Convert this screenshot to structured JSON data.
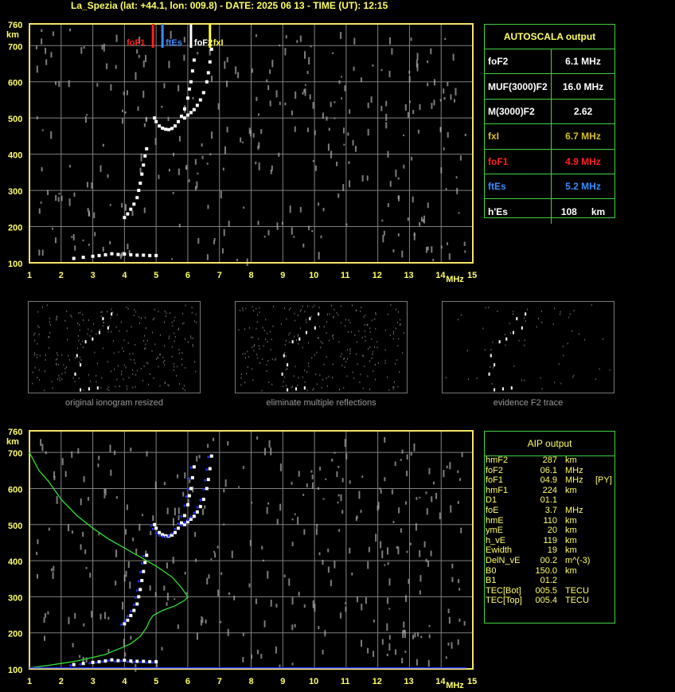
{
  "title": "La_Spezia (lat: +44.1, lon: 009.8) - DATE: 2025 06 13 - TIME (UT): 12:15",
  "colors": {
    "axis": "#f5e36a",
    "grid": "#808080",
    "label": "#ffff66",
    "foF1": "#ff2020",
    "ftEs": "#3a8cff",
    "foF2": "#ffffff",
    "fxI": "#ffff30",
    "profile": "#30e030",
    "trace": "#2030ff"
  },
  "axes": {
    "x_ticks": [
      "1",
      "2",
      "3",
      "4",
      "5",
      "6",
      "7",
      "8",
      "9",
      "10",
      "11",
      "12",
      "13",
      "14",
      "15"
    ],
    "x_unit": "MHz",
    "y_ticks": [
      "100",
      "200",
      "300",
      "400",
      "500",
      "600",
      "700",
      "760"
    ],
    "y_unit": "km",
    "xlim": [
      1,
      15
    ],
    "ylim": [
      100,
      760
    ]
  },
  "markers": [
    {
      "label": "foF1",
      "freq": 4.9,
      "color": "#ff2020"
    },
    {
      "label": "ftEs",
      "freq": 5.2,
      "color": "#3a8cff"
    },
    {
      "label": "foF2",
      "freq": 6.1,
      "color": "#ffffff"
    },
    {
      "label": "fxI",
      "freq": 6.7,
      "color": "#ffff30"
    }
  ],
  "autoscala": {
    "header": "AUTOSCALA output",
    "rows": [
      {
        "label": "foF2",
        "value": "6.1 MHz",
        "color": "#ffffff"
      },
      {
        "label": "MUF(3000)F2",
        "value": "16.0 MHz",
        "color": "#ffffff"
      },
      {
        "label": "M(3000)F2",
        "value": "2.62",
        "color": "#ffffff"
      },
      {
        "label": "fxI",
        "value": "6.7 MHz",
        "color": "#d4c020"
      },
      {
        "label": "foF1",
        "value": "4.9 MHz",
        "color": "#ff2020"
      },
      {
        "label": "ftEs",
        "value": "5.2 MHz",
        "color": "#3a8cff"
      },
      {
        "label": "h'Es",
        "value": "108",
        "unit": "km",
        "color": "#ffffff"
      }
    ]
  },
  "thumbnails": [
    {
      "caption": "original ionogram resized"
    },
    {
      "caption": "eliminate multiple reflections"
    },
    {
      "caption": "evidence F2 trace"
    }
  ],
  "aip": {
    "header": "AIP output",
    "rows": [
      [
        "hmF2",
        "287",
        "km",
        ""
      ],
      [
        "foF2",
        "06.1",
        "MHz",
        ""
      ],
      [
        "foF1",
        "04.9",
        "MHz",
        "[PY]"
      ],
      [
        "hmF1",
        "224",
        "km",
        ""
      ],
      [
        "D1",
        "01.1",
        "",
        ""
      ],
      [
        "foE",
        "3.7",
        "MHz",
        ""
      ],
      [
        "hmE",
        "110",
        "km",
        ""
      ],
      [
        "ymE",
        "20",
        "km",
        ""
      ],
      [
        "h_vE",
        "119",
        "km",
        ""
      ],
      [
        "Ewidth",
        "19",
        "km",
        ""
      ],
      [
        "DelN_vE",
        "00.2",
        "m^(-3)",
        ""
      ],
      [
        "B0",
        "150.0",
        "km",
        ""
      ],
      [
        "B1",
        "01.2",
        "",
        ""
      ],
      [
        "TEC[Bot]",
        "005.5",
        "TECU",
        ""
      ],
      [
        "TEC[Top]",
        "005.4",
        "TECU",
        ""
      ]
    ]
  },
  "chart_data": [
    {
      "type": "scatter",
      "title": "",
      "xlabel": "MHz",
      "ylabel": "km",
      "xlim": [
        1,
        15
      ],
      "ylim": [
        100,
        760
      ],
      "grid": true,
      "series": [
        {
          "name": "E/Es trace",
          "points": [
            [
              2.4,
              112
            ],
            [
              2.7,
              115
            ],
            [
              3.0,
              118
            ],
            [
              3.2,
              120
            ],
            [
              3.4,
              122
            ],
            [
              3.6,
              125
            ],
            [
              3.8,
              123
            ],
            [
              4.0,
              124
            ],
            [
              4.2,
              122
            ],
            [
              4.4,
              121
            ],
            [
              4.6,
              121
            ],
            [
              4.8,
              120
            ],
            [
              5.0,
              120
            ]
          ]
        },
        {
          "name": "F1 trace",
          "points": [
            [
              4.0,
              225
            ],
            [
              4.1,
              235
            ],
            [
              4.2,
              248
            ],
            [
              4.3,
              262
            ],
            [
              4.4,
              280
            ],
            [
              4.45,
              300
            ],
            [
              4.5,
              320
            ],
            [
              4.55,
              345
            ],
            [
              4.6,
              370
            ],
            [
              4.65,
              395
            ],
            [
              4.7,
              415
            ]
          ]
        },
        {
          "name": "F2 ordinary",
          "points": [
            [
              4.95,
              500
            ],
            [
              5.0,
              490
            ],
            [
              5.1,
              478
            ],
            [
              5.2,
              472
            ],
            [
              5.3,
              469
            ],
            [
              5.4,
              468
            ],
            [
              5.5,
              471
            ],
            [
              5.6,
              478
            ],
            [
              5.7,
              490
            ],
            [
              5.8,
              505
            ],
            [
              5.9,
              525
            ],
            [
              6.0,
              555
            ],
            [
              6.05,
              580
            ],
            [
              6.1,
              600
            ],
            [
              6.15,
              630
            ],
            [
              6.2,
              660
            ]
          ]
        },
        {
          "name": "F2 extraordinary",
          "points": [
            [
              5.9,
              500
            ],
            [
              6.0,
              508
            ],
            [
              6.1,
              515
            ],
            [
              6.2,
              523
            ],
            [
              6.3,
              535
            ],
            [
              6.4,
              550
            ],
            [
              6.5,
              570
            ],
            [
              6.6,
              600
            ],
            [
              6.65,
              625
            ],
            [
              6.7,
              655
            ],
            [
              6.75,
              690
            ]
          ]
        }
      ]
    },
    {
      "type": "line",
      "title": "",
      "xlabel": "MHz",
      "ylabel": "km",
      "xlim": [
        1,
        15
      ],
      "ylim": [
        100,
        760
      ],
      "grid": true,
      "series": [
        {
          "name": "electron density profile",
          "x": [
            1.0,
            1.3,
            1.6,
            2.0,
            2.5,
            3.0,
            3.5,
            4.0,
            4.5,
            5.0,
            5.5,
            5.8,
            6.0,
            5.9,
            5.6,
            5.2,
            4.9,
            4.8,
            4.7,
            4.5,
            4.2,
            3.9,
            3.6,
            3.4,
            3.0,
            2.5,
            2.0,
            1.6,
            1.2,
            1.0
          ],
          "y": [
            700,
            650,
            620,
            570,
            525,
            490,
            460,
            435,
            410,
            385,
            355,
            325,
            300,
            290,
            275,
            262,
            248,
            235,
            215,
            190,
            170,
            158,
            148,
            140,
            132,
            122,
            115,
            110,
            105,
            103
          ]
        }
      ]
    }
  ]
}
